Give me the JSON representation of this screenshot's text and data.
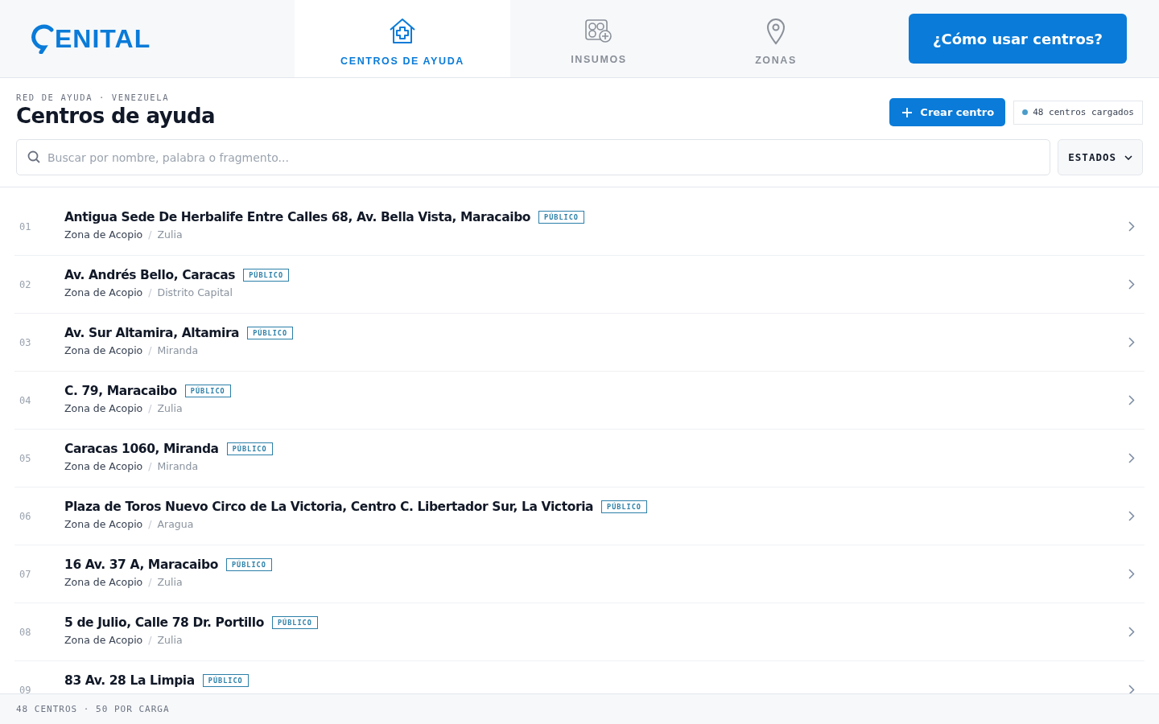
{
  "logo": {
    "text": "ENITAL"
  },
  "tabs": [
    {
      "label": "CENTROS DE AYUDA",
      "selected": true
    },
    {
      "label": "INSUMOS",
      "selected": false
    },
    {
      "label": "ZONAS",
      "selected": false
    }
  ],
  "help_button": "¿Cómo usar centros?",
  "breadcrumb": "RED DE AYUDA · VENEZUELA",
  "title": "Centros de ayuda",
  "create_button": "Crear centro",
  "loaded_badge": "48 centros cargados",
  "search": {
    "placeholder": "Buscar por nombre, palabra o fragmento..."
  },
  "filter_button": "ESTADOS",
  "centers": [
    {
      "number": "01",
      "name": "Antigua Sede De Herbalife Entre Calles 68, Av. Bella Vista, Maracaibo",
      "tag": "PÚBLICO",
      "type": "Zona de Acopio",
      "separator": "/",
      "state": "Zulia"
    },
    {
      "number": "02",
      "name": "Av. Andrés Bello, Caracas",
      "tag": "PÚBLICO",
      "type": "Zona de Acopio",
      "separator": "/",
      "state": "Distrito Capital"
    },
    {
      "number": "03",
      "name": "Av. Sur Altamira, Altamira",
      "tag": "PÚBLICO",
      "type": "Zona de Acopio",
      "separator": "/",
      "state": "Miranda"
    },
    {
      "number": "04",
      "name": "C. 79, Maracaibo",
      "tag": "PÚBLICO",
      "type": "Zona de Acopio",
      "separator": "/",
      "state": "Zulia"
    },
    {
      "number": "05",
      "name": "Caracas 1060, Miranda",
      "tag": "PÚBLICO",
      "type": "Zona de Acopio",
      "separator": "/",
      "state": "Miranda"
    },
    {
      "number": "06",
      "name": "Plaza de Toros Nuevo Circo de La Victoria, Centro C. Libertador Sur, La Victoria",
      "tag": "PÚBLICO",
      "type": "Zona de Acopio",
      "separator": "/",
      "state": "Aragua"
    },
    {
      "number": "07",
      "name": "16 Av. 37 A, Maracaibo",
      "tag": "PÚBLICO",
      "type": "Zona de Acopio",
      "separator": "/",
      "state": "Zulia"
    },
    {
      "number": "08",
      "name": "5 de Julio, Calle 78 Dr. Portillo",
      "tag": "PÚBLICO",
      "type": "Zona de Acopio",
      "separator": "/",
      "state": "Zulia"
    },
    {
      "number": "09",
      "name": "83 Av. 28 La Limpia",
      "tag": "PÚBLICO"
    }
  ],
  "footer": "48 CENTROS · 50 POR CARGA"
}
